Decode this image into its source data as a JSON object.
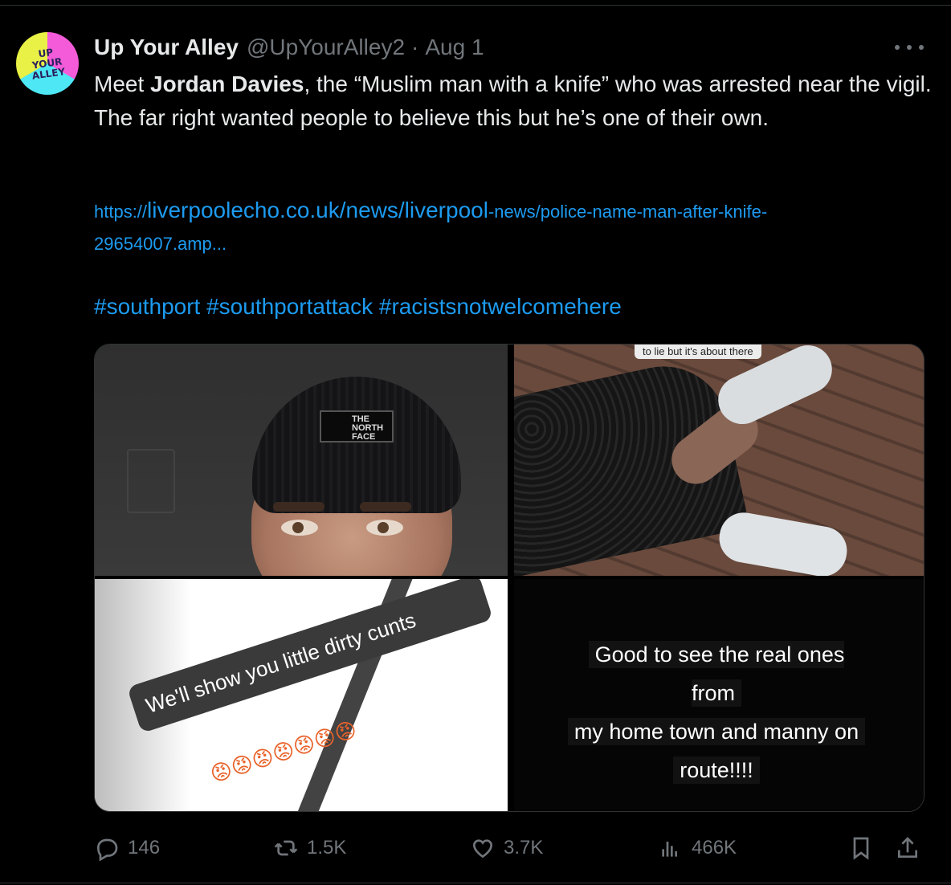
{
  "tweet": {
    "author_name": "Up Your Alley",
    "handle": "@UpYourAlley2",
    "separator": "·",
    "date": "Aug 1",
    "avatar_text": [
      "UP",
      "YOUR",
      "ALLEY"
    ],
    "text_before": "Meet ",
    "text_bold": "Jordan Davies",
    "text_after": ", the “Muslim man with a knife” who was arrested near the vigil. The far right wanted people to believe this but he’s one of their own.",
    "link": {
      "scheme": "https://",
      "domain": "liverpoolecho.co.uk/news/liverpool",
      "path": "-news/police-name-man-after-knife-",
      "path2": "29654007.amp..."
    },
    "hashtags": "#southport #southportattack #racistsnotwelcomehere"
  },
  "media": {
    "beanie_logo": "THE NORTH FACE",
    "top_right_caption": "to lie but it's about there",
    "bottom_left_caption": "We'll show you little dirty cunts",
    "bottom_left_emojis": "😡😡😡😡😡😡😡",
    "bottom_right_caption": [
      "Good to see the real ones from",
      "my home town and manny on",
      "route!!!!"
    ]
  },
  "actions": {
    "replies": "146",
    "retweets": "1.5K",
    "likes": "3.7K",
    "views": "466K"
  },
  "icons": {
    "reply": "reply-icon",
    "retweet": "retweet-icon",
    "like": "heart-icon",
    "views": "views-icon",
    "bookmark": "bookmark-icon",
    "share": "share-icon",
    "more": "more-icon"
  },
  "colors": {
    "background": "#000000",
    "text": "#e7e9ea",
    "muted": "#71767b",
    "link": "#1d9bf0",
    "border": "#2f3336"
  }
}
